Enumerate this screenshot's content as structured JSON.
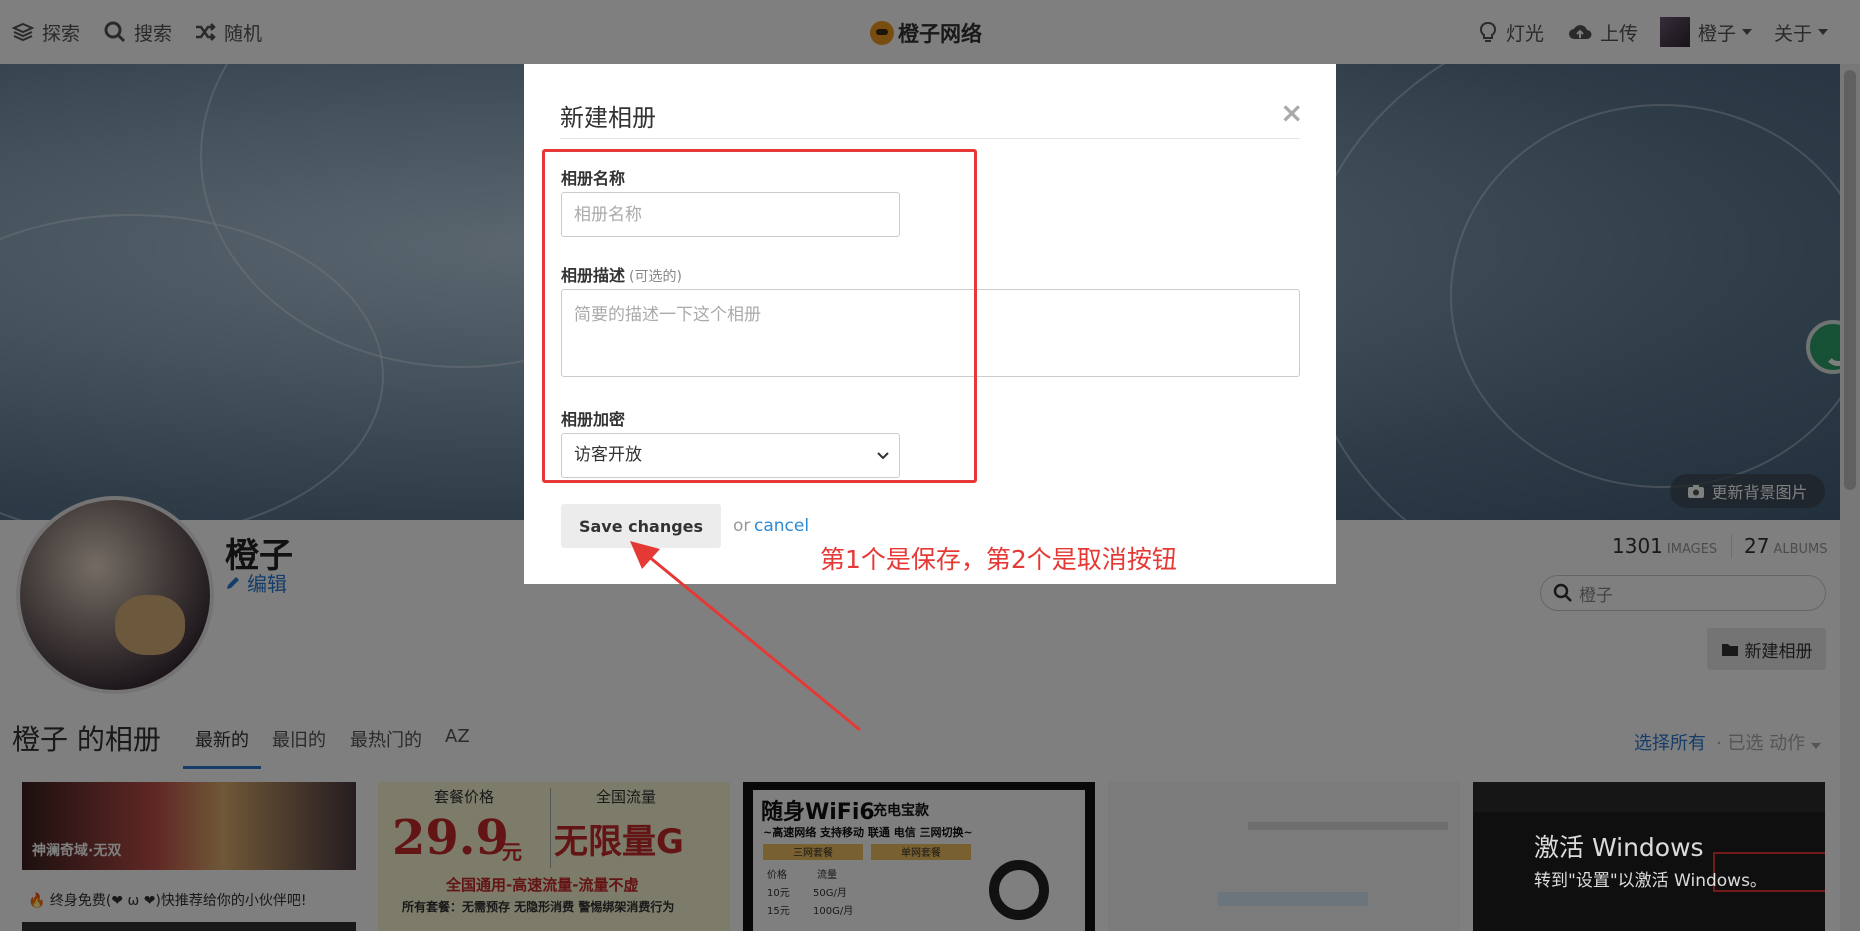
{
  "nav": {
    "explore": "探索",
    "search": "搜索",
    "random": "随机",
    "brand": "橙子网络",
    "lights": "灯光",
    "upload": "上传",
    "user": "橙子",
    "about": "关于"
  },
  "banner": {
    "change_bg": "更新背景图片"
  },
  "profile": {
    "name": "橙子",
    "edit": "编辑",
    "images_count": "1301",
    "images_label": "IMAGES",
    "albums_count": "27",
    "albums_label": "ALBUMS",
    "search_placeholder": "橙子",
    "new_album": "新建相册"
  },
  "albums": {
    "title": "橙子 的相册",
    "tabs": [
      "最新的",
      "最旧的",
      "最热门的",
      "AZ"
    ],
    "select_all": "选择所有",
    "selected": "· 已选 动作",
    "thumb1_caption": "终身免费(❤ ω ❤)快推荐给你的小伙伴吧!",
    "thumb1_game": "神澜奇域·无双",
    "thumb2": {
      "label_a": "套餐价格",
      "label_b": "全国流量",
      "price": "29.9",
      "unit": "元",
      "unlimited": "无限量G",
      "line1": "全国通用-高速流量-流量不虚",
      "line2": "所有套餐：无需预存 无隐形消费 警惕绑架消费行为"
    },
    "thumb3": {
      "title": "随身WiFi6",
      "sub": "充电宝款",
      "line": "~高速网络 支持移动 联通 电信 三网切换~",
      "col_a": "三网套餐",
      "col_b": "单网套餐",
      "h1": "价格",
      "h2": "流量",
      "r1a": "10元",
      "r1b": "50G/月",
      "r2a": "15元",
      "r2b": "100G/月"
    }
  },
  "modal": {
    "title": "新建相册",
    "close": "×",
    "name_label": "相册名称",
    "name_placeholder": "相册名称",
    "desc_label": "相册描述",
    "desc_optional": "(可选的)",
    "desc_placeholder": "简要的描述一下这个相册",
    "privacy_label": "相册加密",
    "privacy_value": "访客开放",
    "save": "Save changes",
    "or": "or",
    "cancel": "cancel"
  },
  "annotation": "第1个是保存，第2个是取消按钮",
  "watermark": {
    "line1": "激活 Windows",
    "line2": "转到\"设置\"以激活 Windows。"
  },
  "colors": {
    "accent": "#2a7ad3",
    "annotation_red": "#e53935",
    "overlay": "rgba(0,0,0,0.5)"
  }
}
